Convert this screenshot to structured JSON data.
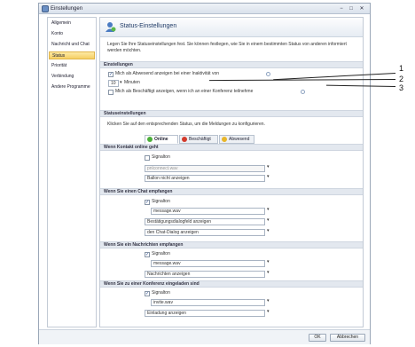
{
  "window": {
    "title": "Einstellungen",
    "min": "−",
    "max": "□",
    "close": "✕"
  },
  "sidebar": {
    "items": [
      {
        "label": "Allgemein"
      },
      {
        "label": "Konto"
      },
      {
        "label": "Nachricht und Chat"
      },
      {
        "label": "Status"
      },
      {
        "label": "Priorität"
      },
      {
        "label": "Verbindung"
      },
      {
        "label": "Andere Programme"
      }
    ]
  },
  "header": {
    "title": "Status-Einstellungen"
  },
  "description": "Legen Sie Ihre Statuseinstellungen fest. Sie können festlegen, wie Sie in einem bestimmten Status von anderen informiert werden möchten.",
  "settings": {
    "title": "Einstellungen",
    "away_label": "Mich als Abwesend anzeigen bei einer Inaktivität von",
    "away_value": "10",
    "minutes_label": "Minuten",
    "busy_label": "Mich als Beschäftigt anzeigen, wenn ich an einer Konferenz teilnehme"
  },
  "status_settings": {
    "title": "Statuseinstellungen",
    "hint": "Klicken Sie auf den entsprechenden Status, um die Meldungen zu konfigurieren.",
    "tabs": [
      {
        "label": "Online"
      },
      {
        "label": "Beschäftigt"
      },
      {
        "label": "Abwesend"
      }
    ]
  },
  "sections": [
    {
      "title": "Wenn Kontakt online geht",
      "signal_label": "Signalton",
      "sound": "pnlconnect.wav",
      "action": "Ballon nicht anzeigen"
    },
    {
      "title": "Wenn Sie einen Chat empfangen",
      "signal_label": "Signalton",
      "sound": "message.wav",
      "action": "Bestätigungsdialogfeld anzeigen",
      "action2": "den Chat-Dialog anzeigen"
    },
    {
      "title": "Wenn Sie ein Nachrichten empfangen",
      "signal_label": "Signalton",
      "sound": "message.wav",
      "action": "Nachrichten anzeigen"
    },
    {
      "title": "Wenn Sie zu einer Konferenz eingeladen sind",
      "signal_label": "Signalton",
      "sound": "invite.wav",
      "action": "Einladung anzeigen"
    }
  ],
  "footer": {
    "ok": "OK",
    "cancel": "Abbrechen"
  },
  "callouts": [
    "1",
    "2",
    "3"
  ],
  "colors": {
    "accent": "#1f3a66",
    "selected": "#f6cf63"
  }
}
